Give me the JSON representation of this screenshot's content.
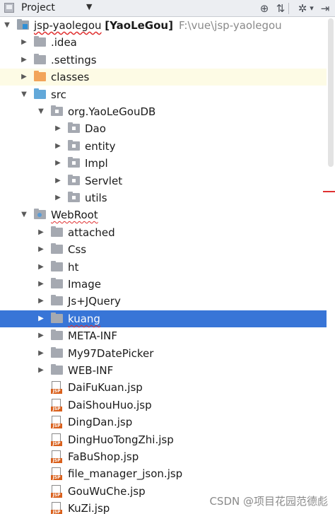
{
  "toolbar": {
    "title": "Project",
    "dropdown_icon": "caret-down-icon",
    "buttons": [
      {
        "name": "locate-icon",
        "glyph": "⊕"
      },
      {
        "name": "collapse-all-icon",
        "glyph": "⇅"
      },
      {
        "name": "settings-gear-icon",
        "glyph": "✲"
      },
      {
        "name": "settings-dropdown-icon",
        "glyph": "▾"
      },
      {
        "name": "hide-panel-icon",
        "glyph": "⇥"
      }
    ]
  },
  "tree": {
    "root": {
      "name": "jsp-yaolegou",
      "module": "[YaoLeGou]",
      "path": "F:\\vue\\jsp-yaolegou"
    },
    "items": [
      {
        "label": "jsp-yaolegou",
        "depth": 0,
        "arrow": "▼",
        "icon": "module"
      },
      {
        "label": ".idea",
        "depth": 1,
        "arrow": "▶",
        "icon": "folder"
      },
      {
        "label": ".settings",
        "depth": 1,
        "arrow": "▶",
        "icon": "folder"
      },
      {
        "label": "classes",
        "depth": 1,
        "arrow": "▶",
        "icon": "folder-orange",
        "highlight": "yellow"
      },
      {
        "label": "src",
        "depth": 1,
        "arrow": "▼",
        "icon": "folder-blue"
      },
      {
        "label": "org.YaoLeGouDB",
        "depth": 2,
        "arrow": "▼",
        "icon": "package"
      },
      {
        "label": "Dao",
        "depth": 3,
        "arrow": "▶",
        "icon": "package"
      },
      {
        "label": "entity",
        "depth": 3,
        "arrow": "▶",
        "icon": "package"
      },
      {
        "label": "Impl",
        "depth": 3,
        "arrow": "▶",
        "icon": "package"
      },
      {
        "label": "Servlet",
        "depth": 3,
        "arrow": "▶",
        "icon": "package"
      },
      {
        "label": "utils",
        "depth": 3,
        "arrow": "▶",
        "icon": "package"
      },
      {
        "label": "WebRoot",
        "depth": 1,
        "arrow": "▼",
        "icon": "folder-web",
        "squiggle": true
      },
      {
        "label": "attached",
        "depth": 2,
        "arrow": "▶",
        "icon": "folder"
      },
      {
        "label": "Css",
        "depth": 2,
        "arrow": "▶",
        "icon": "folder"
      },
      {
        "label": "ht",
        "depth": 2,
        "arrow": "▶",
        "icon": "folder"
      },
      {
        "label": "Image",
        "depth": 2,
        "arrow": "▶",
        "icon": "folder"
      },
      {
        "label": "Js+JQuery",
        "depth": 2,
        "arrow": "▶",
        "icon": "folder"
      },
      {
        "label": "kuang",
        "depth": 2,
        "arrow": "▶",
        "icon": "folder",
        "highlight": "blue",
        "squiggle": true
      },
      {
        "label": "META-INF",
        "depth": 2,
        "arrow": "▶",
        "icon": "folder"
      },
      {
        "label": "My97DatePicker",
        "depth": 2,
        "arrow": "▶",
        "icon": "folder"
      },
      {
        "label": "WEB-INF",
        "depth": 2,
        "arrow": "▶",
        "icon": "folder"
      },
      {
        "label": "DaiFuKuan.jsp",
        "depth": 2,
        "arrow": "",
        "icon": "jsp"
      },
      {
        "label": "DaiShouHuo.jsp",
        "depth": 2,
        "arrow": "",
        "icon": "jsp"
      },
      {
        "label": "DingDan.jsp",
        "depth": 2,
        "arrow": "",
        "icon": "jsp"
      },
      {
        "label": "DingHuoTongZhi.jsp",
        "depth": 2,
        "arrow": "",
        "icon": "jsp"
      },
      {
        "label": "FaBuShop.jsp",
        "depth": 2,
        "arrow": "",
        "icon": "jsp"
      },
      {
        "label": "file_manager_json.jsp",
        "depth": 2,
        "arrow": "",
        "icon": "jsp"
      },
      {
        "label": "GouWuChe.jsp",
        "depth": 2,
        "arrow": "",
        "icon": "jsp"
      },
      {
        "label": "KuZi.jsp",
        "depth": 2,
        "arrow": "",
        "icon": "jsp"
      }
    ]
  },
  "jsp_badge": "JSP",
  "watermark": "CSDN @项目花园范德彪"
}
